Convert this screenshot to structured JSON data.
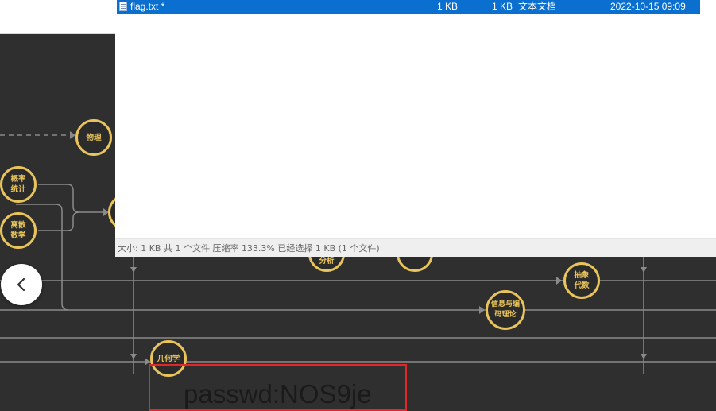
{
  "archive": {
    "file": {
      "name": "flag.txt *",
      "size": "1 KB",
      "packed_size": "1 KB",
      "type": "文本文档",
      "modified": "2022-10-15 09:09"
    },
    "status_text": "大小: 1 KB 共 1 个文件 压缩率 133.3% 已经选择 1 KB (1 个文件)"
  },
  "map": {
    "nodes": {
      "physics": "物理",
      "probability": "概率\n统计",
      "discrete": "离散\n数学",
      "analysis_partial": "分析",
      "abstract_algebra": "抽象\n代数",
      "info_coding": "信息与编\n码理论",
      "geometry": "几何学"
    }
  },
  "annotation": {
    "password": "passwd:NOS9je"
  },
  "colors": {
    "background": "#2f2f2f",
    "node_border": "#e9c45a",
    "selection": "#0a6fcf",
    "highlight_box": "#e4252a"
  },
  "icons": {
    "back": "chevron-left-icon",
    "file": "text-file-icon"
  }
}
